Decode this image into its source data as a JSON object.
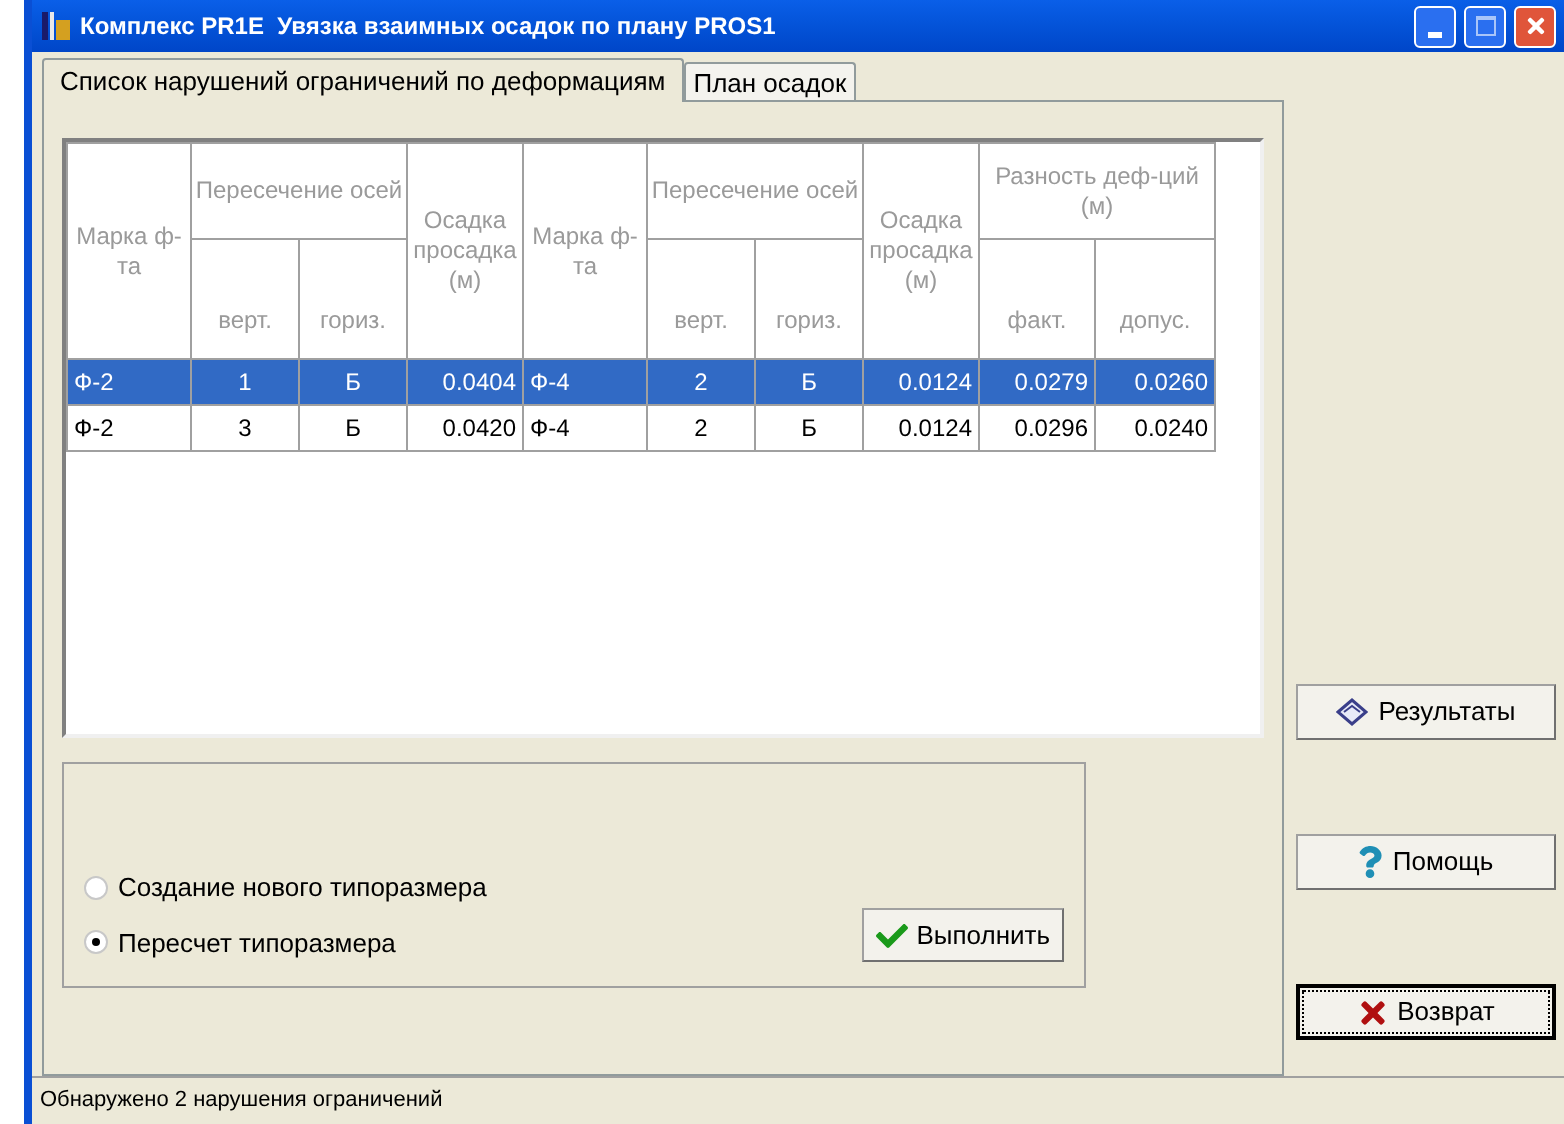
{
  "window": {
    "title": "Комплекс PR1E  Увязка взаимных осадок по плану PROS1"
  },
  "tabs": [
    {
      "label": "Список нарушений ограничений по деформациям",
      "selected": true
    },
    {
      "label": "План осадок",
      "selected": false
    }
  ],
  "table": {
    "columns": [
      {
        "label": "Марка ф-та"
      },
      {
        "label": "Пересечение осей",
        "colspan": 2,
        "children": [
          {
            "label": "верт."
          },
          {
            "label": "гориз."
          }
        ]
      },
      {
        "label": "Осадка просадка (м)"
      },
      {
        "label": "Марка ф-та"
      },
      {
        "label": "Пересечение осей",
        "colspan": 2,
        "children": [
          {
            "label": "верт."
          },
          {
            "label": "гориз."
          }
        ]
      },
      {
        "label": "Осадка просадка (м)"
      },
      {
        "label": "Разность деф-ций (м)",
        "colspan": 2,
        "children": [
          {
            "label": "факт."
          },
          {
            "label": "допус."
          }
        ]
      }
    ],
    "rows": [
      {
        "selected": true,
        "cells": [
          "Ф-2",
          "1",
          "Б",
          "0.0404",
          "Ф-4",
          "2",
          "Б",
          "0.0124",
          "0.0279",
          "0.0260"
        ]
      },
      {
        "selected": false,
        "cells": [
          "Ф-2",
          "3",
          "Б",
          "0.0420",
          "Ф-4",
          "2",
          "Б",
          "0.0124",
          "0.0296",
          "0.0240"
        ]
      }
    ]
  },
  "options": [
    {
      "label": "Создание нового типоразмера",
      "selected": false
    },
    {
      "label": "Пересчет типоразмера",
      "selected": true
    }
  ],
  "execute_button": {
    "label": "Выполнить"
  },
  "side_buttons": [
    {
      "kind": "results",
      "label": "Результаты",
      "focused": false
    },
    {
      "kind": "help",
      "label": "Помощь",
      "focused": false
    },
    {
      "kind": "return",
      "label": "Возврат",
      "focused": true
    }
  ],
  "status_bar": {
    "text": "Обнаружено 2 нарушения ограничений"
  }
}
